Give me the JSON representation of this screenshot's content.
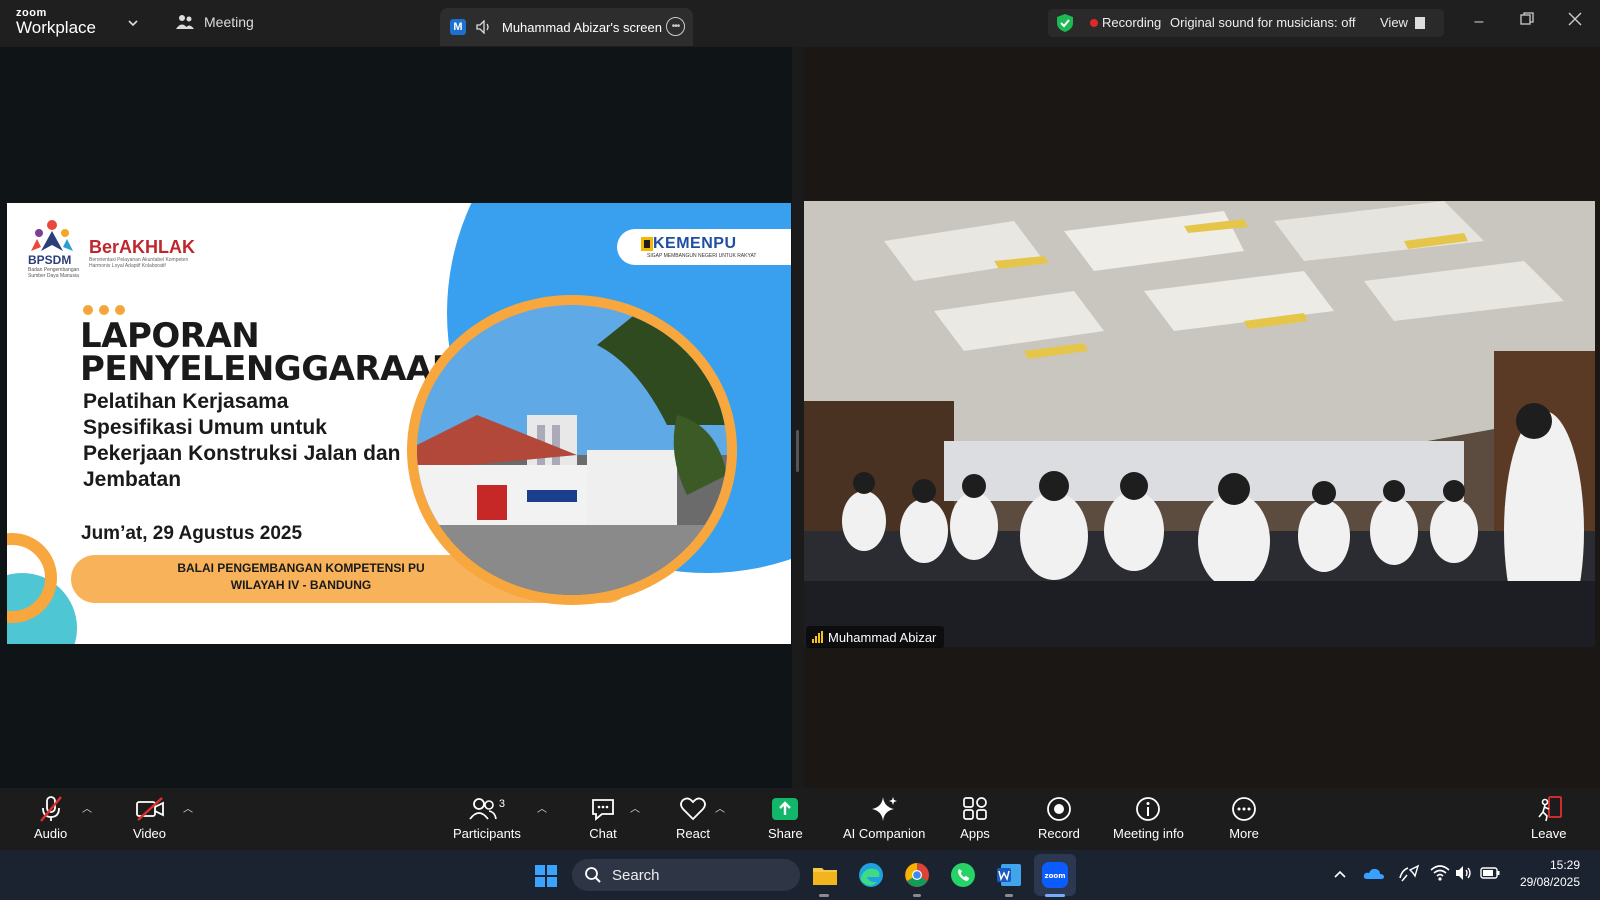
{
  "titlebar": {
    "brand_top": "zoom",
    "brand_bottom": "Workplace",
    "meeting_tab": "Meeting",
    "screen_tab_badge": "M",
    "screen_tab_label": "Muhammad Abizar's screen",
    "recording_label": "Recording",
    "original_sound": "Original sound for musicians: off",
    "view_label": "View"
  },
  "slide": {
    "bpsdm": "BPSDM",
    "bpsdm_sub": "Badan Pengembangan Sumber Daya Manusia",
    "berakhlak": "BerAKHLAK",
    "berakhlak_sub": "Berorientasi Pelayanan Akuntabel Kompeten Harmonis Loyal Adaptif Kolaboratif",
    "kemenpu": "KEMENPU",
    "kemenpu_sub": "SIGAP MEMBANGUN NEGERI UNTUK RAKYAT",
    "title_line1": "LAPORAN",
    "title_line2": "PENYELENGGARAAN",
    "subtitle": "Pelatihan Kerjasama Spesifikasi Umum untuk Pekerjaan Konstruksi Jalan dan Jembatan",
    "date": "Jum’at, 29 Agustus 2025",
    "org_line1": "BALAI PENGEMBANGAN KOMPETENSI PU",
    "org_line2": "WILAYAH IV - BANDUNG"
  },
  "camera": {
    "participant_name": "Muhammad Abizar"
  },
  "toolbar": {
    "audio": "Audio",
    "video": "Video",
    "participants": "Participants",
    "participants_count": "3",
    "chat": "Chat",
    "react": "React",
    "share": "Share",
    "ai_companion": "AI Companion",
    "apps": "Apps",
    "record": "Record",
    "meeting_info": "Meeting info",
    "more": "More",
    "leave": "Leave"
  },
  "taskbar": {
    "search_label": "Search",
    "time": "15:29",
    "date": "29/08/2025"
  },
  "colors": {
    "share_green": "#12b76a",
    "recording_red": "#e02828",
    "leave_red": "#e02e2e",
    "slide_orange": "#f8b35a",
    "slide_blue": "#39a0ef"
  }
}
